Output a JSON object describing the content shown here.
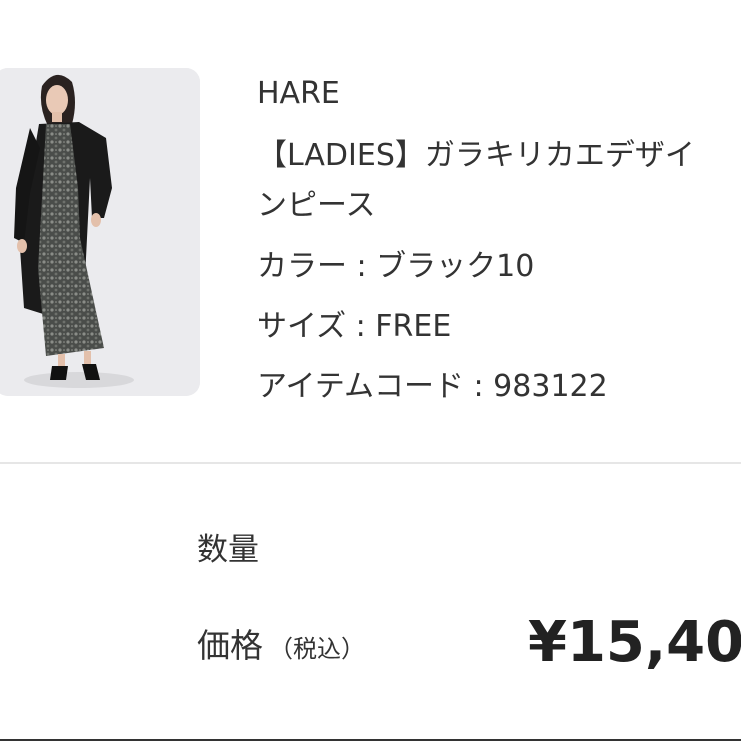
{
  "product": {
    "brand": "HARE",
    "name_line1": "【LADIES】ガラキリカエデザイ",
    "name_line2": "ンピース",
    "color": "カラー : ブラック10",
    "size": "サイズ : FREE",
    "item_code": "アイテムコード : 983122",
    "image_icon": "product-photo-dress"
  },
  "order": {
    "quantity_label": "数量",
    "price_label": "価格",
    "tax_note": "（税込）",
    "price_value": "¥15,40"
  }
}
